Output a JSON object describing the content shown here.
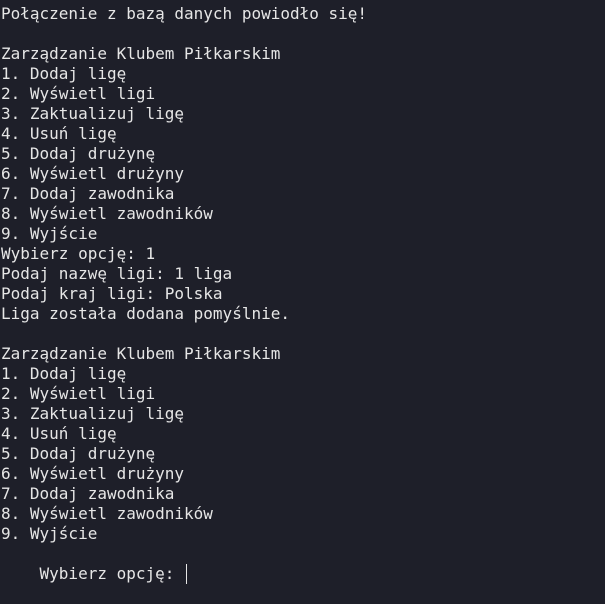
{
  "terminal": {
    "lines": [
      "Połączenie z bazą danych powiodło się!",
      "",
      "Zarządzanie Klubem Piłkarskim",
      "1. Dodaj ligę",
      "2. Wyświetl ligi",
      "3. Zaktualizuj ligę",
      "4. Usuń ligę",
      "5. Dodaj drużynę",
      "6. Wyświetl drużyny",
      "7. Dodaj zawodnika",
      "8. Wyświetl zawodników",
      "9. Wyjście",
      "Wybierz opcję: 1",
      "Podaj nazwę ligi: 1 liga",
      "Podaj kraj ligi: Polska",
      "Liga została dodana pomyślnie.",
      "",
      "Zarządzanie Klubem Piłkarskim",
      "1. Dodaj ligę",
      "2. Wyświetl ligi",
      "3. Zaktualizuj ligę",
      "4. Usuń ligę",
      "5. Dodaj drużynę",
      "6. Wyświetl drużyny",
      "7. Dodaj zawodnika",
      "8. Wyświetl zawodników",
      "9. Wyjście"
    ],
    "prompt": "Wybierz opcję: ",
    "input": ""
  },
  "colors": {
    "background": "#1e1f29",
    "text": "#e6e6e6"
  }
}
